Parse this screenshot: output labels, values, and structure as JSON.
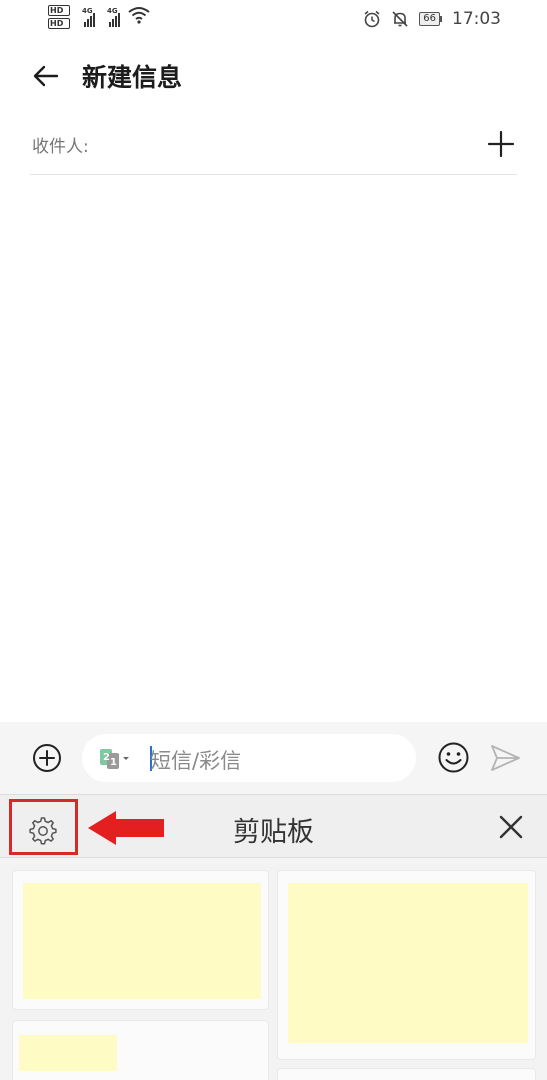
{
  "status_bar": {
    "hd1": "HD",
    "hd2": "HD",
    "net1": "4G",
    "net2": "4G",
    "battery": "66",
    "time": "17:03"
  },
  "header": {
    "title": "新建信息",
    "icons": {
      "back": "arrow-left"
    }
  },
  "recipient": {
    "label": "收件人:",
    "icons": {
      "add": "plus"
    }
  },
  "compose": {
    "placeholder": "短信/彩信",
    "icons": {
      "attach": "plus-circle",
      "sim": "sim-switch",
      "emoji": "smiley",
      "send": "send-arrow"
    }
  },
  "clipboard": {
    "title": "剪贴板",
    "icons": {
      "settings": "gear",
      "close": "x"
    },
    "annotation_color": "#d42a2a",
    "cards": [
      "",
      "",
      "",
      ""
    ]
  },
  "colors": {
    "accent": "#2a6fd6",
    "highlight": "#fefbc4",
    "annotation": "#d42a2a"
  }
}
